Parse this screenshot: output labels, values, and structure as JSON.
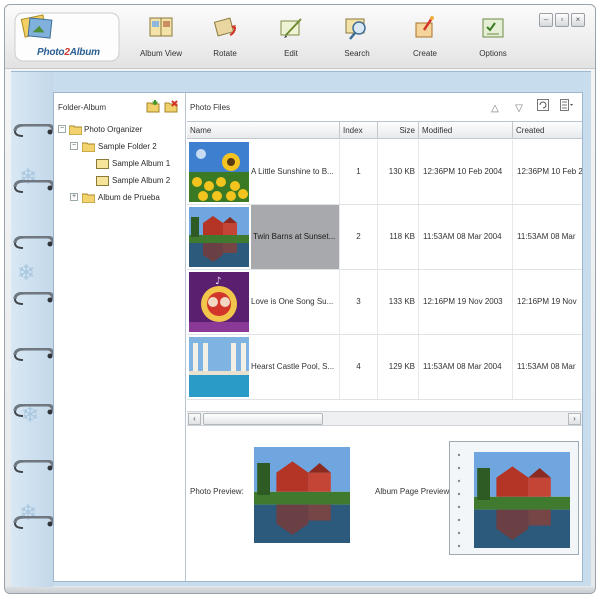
{
  "app": {
    "logo_text_a": "Photo",
    "logo_text_num": "2",
    "logo_text_b": "Album"
  },
  "toolbar": {
    "items": [
      {
        "label": "Album View",
        "icon": "album-view-icon"
      },
      {
        "label": "Rotate",
        "icon": "rotate-icon"
      },
      {
        "label": "Edit",
        "icon": "edit-icon"
      },
      {
        "label": "Search",
        "icon": "search-icon"
      },
      {
        "label": "Create",
        "icon": "create-icon"
      },
      {
        "label": "Options",
        "icon": "options-icon"
      }
    ]
  },
  "window_buttons": [
    "–",
    "▫",
    "×"
  ],
  "tree_pane": {
    "header": "Folder-Album",
    "nodes": [
      {
        "label": "Photo Organizer",
        "expander": "−"
      },
      {
        "label": "Sample Folder 2",
        "expander": "−"
      },
      {
        "label": "Sample Album 1",
        "expander": ""
      },
      {
        "label": "Sample Album 2",
        "expander": ""
      },
      {
        "label": "Album de Prueba",
        "expander": "+"
      }
    ]
  },
  "files_pane": {
    "header": "Photo Files",
    "columns": [
      "Name",
      "Index",
      "Size",
      "Modified",
      "Created"
    ],
    "rows": [
      {
        "name": "A Little Sunshine to B...",
        "index": "1",
        "size": "130 KB",
        "modified": "12:36PM 10 Feb 2004",
        "created": "12:36PM 10 Feb 2"
      },
      {
        "name": "Twin Barns at Sunset...",
        "index": "2",
        "size": "118 KB",
        "modified": "11:53AM 08 Mar 2004",
        "created": "11:53AM 08 Mar"
      },
      {
        "name": "Love is One Song Su...",
        "index": "3",
        "size": "133 KB",
        "modified": "12:16PM 19 Nov 2003",
        "created": "12:16PM 19 Nov"
      },
      {
        "name": "Hearst Castle Pool, S...",
        "index": "4",
        "size": "129 KB",
        "modified": "11:53AM 08 Mar 2004",
        "created": "11:53AM 08 Mar"
      }
    ]
  },
  "preview": {
    "photo_label": "Photo Preview:",
    "album_label": "Album Page Preview"
  },
  "colors": {
    "accent_blue": "#c7dcec",
    "selection_gray": "#a7a9ac"
  }
}
